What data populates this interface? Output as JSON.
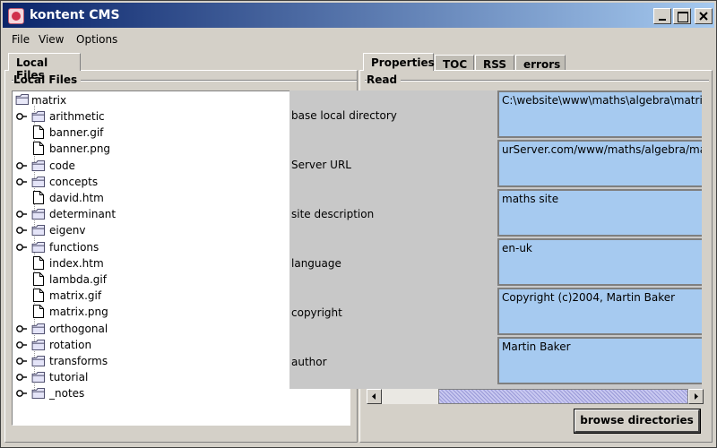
{
  "window": {
    "title": "kontent CMS"
  },
  "menu": [
    "File",
    "View",
    "Options"
  ],
  "left": {
    "tab": "Local Files",
    "group_label": "Local Files",
    "tree": {
      "root": "matrix",
      "items": [
        {
          "label": "arithmetic",
          "type": "folder"
        },
        {
          "label": "banner.gif",
          "type": "file"
        },
        {
          "label": "banner.png",
          "type": "file"
        },
        {
          "label": "code",
          "type": "folder"
        },
        {
          "label": "concepts",
          "type": "folder"
        },
        {
          "label": "david.htm",
          "type": "file"
        },
        {
          "label": "determinant",
          "type": "folder"
        },
        {
          "label": "eigenv",
          "type": "folder"
        },
        {
          "label": "functions",
          "type": "folder"
        },
        {
          "label": "index.htm",
          "type": "file"
        },
        {
          "label": "lambda.gif",
          "type": "file"
        },
        {
          "label": "matrix.gif",
          "type": "file"
        },
        {
          "label": "matrix.png",
          "type": "file"
        },
        {
          "label": "orthogonal",
          "type": "folder"
        },
        {
          "label": "rotation",
          "type": "folder"
        },
        {
          "label": "transforms",
          "type": "folder"
        },
        {
          "label": "tutorial",
          "type": "folder"
        },
        {
          "label": "_notes",
          "type": "folder"
        }
      ]
    }
  },
  "right": {
    "tabs": [
      "Properties",
      "TOC",
      "RSS",
      "errors"
    ],
    "group_label": "Read",
    "properties": [
      {
        "label": "base local directory",
        "value": "C:\\website\\www\\maths\\algebra\\matrix"
      },
      {
        "label": "Server URL",
        "value": "urServer.com/www/maths/algebra/matrix"
      },
      {
        "label": "site description",
        "value": "maths site"
      },
      {
        "label": "language",
        "value": "en-uk"
      },
      {
        "label": "copyright",
        "value": "Copyright (c)2004, Martin Baker"
      },
      {
        "label": "author",
        "value": "Martin Baker"
      }
    ],
    "button": "browse directories"
  },
  "colors": {
    "title_start": "#0a246a",
    "title_end": "#a6caf0",
    "field_bg": "#a6caf0",
    "chrome": "#d4d0c8"
  }
}
